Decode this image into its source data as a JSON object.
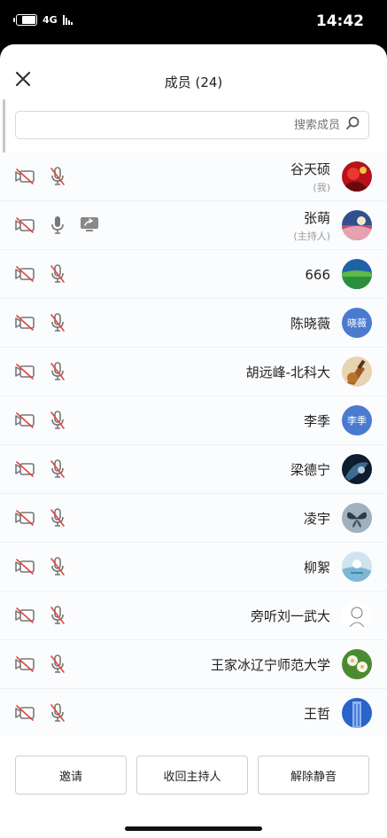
{
  "status_bar": {
    "time": "14:42",
    "network": "4G"
  },
  "header": {
    "title": "成员 (24)"
  },
  "search": {
    "placeholder": "搜索成员"
  },
  "members": [
    {
      "name": "谷天硕",
      "role": "(我)",
      "avatar": "photo-red",
      "screen_share": false
    },
    {
      "name": "张萌",
      "role": "(主持人)",
      "avatar": "photo-sky",
      "screen_share": true
    },
    {
      "name": "666",
      "role": "",
      "avatar": "photo-landscape",
      "screen_share": false
    },
    {
      "name": "陈晓薇",
      "role": "",
      "avatar": "text",
      "avatar_text": "晓薇",
      "screen_share": false
    },
    {
      "name": "胡远峰-北科大",
      "role": "",
      "avatar": "photo-guitar",
      "screen_share": false
    },
    {
      "name": "李季",
      "role": "",
      "avatar": "text",
      "avatar_text": "李季",
      "screen_share": false
    },
    {
      "name": "梁德宁",
      "role": "",
      "avatar": "photo-dark",
      "screen_share": false
    },
    {
      "name": "凌宇",
      "role": "",
      "avatar": "photo-butterfly",
      "screen_share": false
    },
    {
      "name": "柳絮",
      "role": "",
      "avatar": "photo-water",
      "screen_share": false
    },
    {
      "name": "旁听刘一武大",
      "role": "",
      "avatar": "photo-sketch",
      "screen_share": false
    },
    {
      "name": "王家冰辽宁师范大学",
      "role": "",
      "avatar": "photo-flowers",
      "screen_share": false
    },
    {
      "name": "王哲",
      "role": "",
      "avatar": "photo-building",
      "screen_share": false
    }
  ],
  "footer": {
    "unmute_all": "解除静音",
    "reclaim_host": "收回主持人",
    "invite": "邀请"
  },
  "colors": {
    "accent": "#4a7bd0",
    "muted_red": "#e0463c",
    "icon_gray": "#777777"
  }
}
